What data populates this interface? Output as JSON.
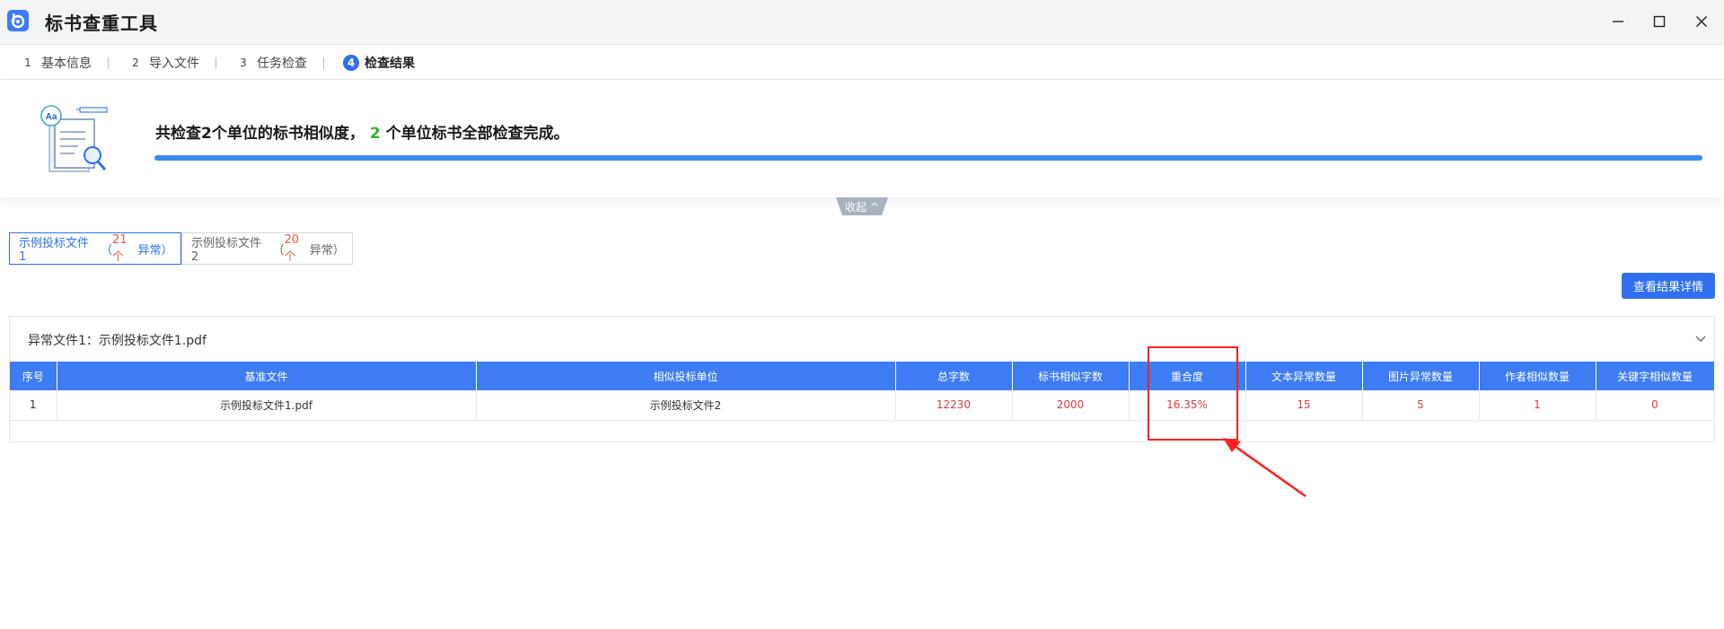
{
  "window": {
    "title": "标书查重工具",
    "controls": [
      "minimize",
      "maximize",
      "close"
    ]
  },
  "steps": [
    {
      "num": "1",
      "label": "基本信息",
      "active": false
    },
    {
      "num": "2",
      "label": "导入文件",
      "active": false
    },
    {
      "num": "3",
      "label": "任务检查",
      "active": false
    },
    {
      "num": "4",
      "label": "检查结果",
      "active": true
    }
  ],
  "summary": {
    "prefix": "共检查2个单位的标书相似度，",
    "count": "2",
    "suffix": "个单位标书全部检查完成。",
    "progress_percent": 100
  },
  "collapse_label": "收起 ^",
  "file_tabs": [
    {
      "name": "示例投标文件1",
      "count": "21个",
      "suffix": "异常）",
      "open": "（",
      "active": true
    },
    {
      "name": "示例投标文件2",
      "count": "20个",
      "suffix": "异常）",
      "open": "（",
      "active": false
    }
  ],
  "detail_button": "查看结果详情",
  "panel": {
    "title": "异常文件1：示例投标文件1.pdf"
  },
  "table": {
    "headers": [
      "序号",
      "基准文件",
      "相似投标单位",
      "总字数",
      "标书相似字数",
      "重合度",
      "文本异常数量",
      "图片异常数量",
      "作者相似数量",
      "关键字相似数量"
    ],
    "rows": [
      [
        "1",
        "示例投标文件1.pdf",
        "示例投标文件2",
        "12230",
        "2000",
        "16.35%",
        "15",
        "5",
        "1",
        "0"
      ]
    ]
  },
  "colors": {
    "accent": "#2f6ff0",
    "table_header": "#3d7cf2",
    "highlight_red": "#ff1f1f",
    "value_red": "#e23a3a",
    "count_orange": "#f05a3c",
    "success_green": "#2cb52c"
  },
  "icons": {
    "app": "app-logo-icon",
    "minimize": "minimize-icon",
    "maximize": "maximize-icon",
    "close": "close-icon",
    "illustration": "document-search-icon",
    "expand": "chevron-down-icon"
  }
}
